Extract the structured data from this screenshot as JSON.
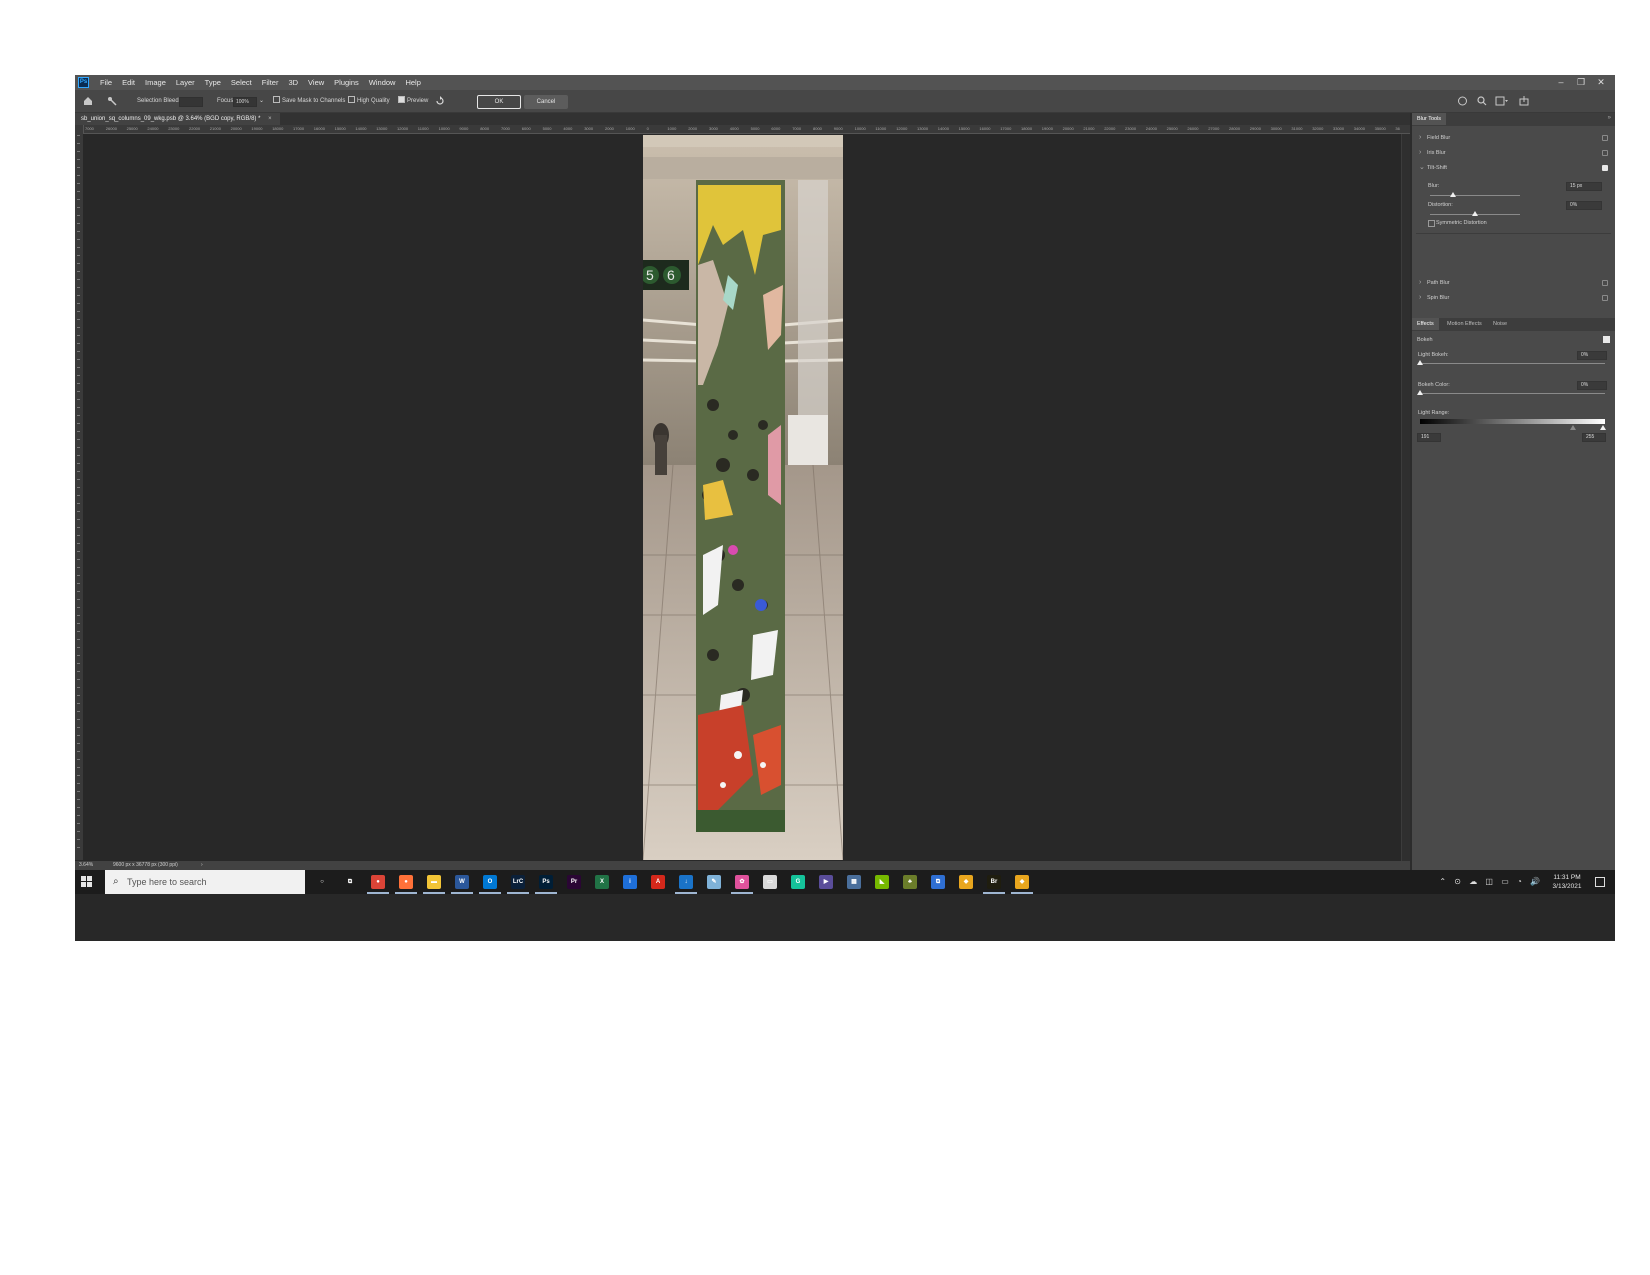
{
  "app": {
    "logo": "Ps",
    "menus": [
      "File",
      "Edit",
      "Image",
      "Layer",
      "Type",
      "Select",
      "Filter",
      "3D",
      "View",
      "Plugins",
      "Window",
      "Help"
    ],
    "window_controls": [
      "–",
      "❐",
      "✕"
    ]
  },
  "options_bar": {
    "selection_bleed_label": "Selection Bleed:",
    "focus_label": "Focus:",
    "focus_value": "100%",
    "save_mask_label": "Save Mask to Channels",
    "high_quality_label": "High Quality",
    "preview_label": "Preview",
    "preview_checked": true,
    "ok_label": "OK",
    "cancel_label": "Cancel"
  },
  "document": {
    "tab_title": "sb_union_sq_columns_09_wkg.psb @ 3.64% (BGD copy, RGB/8) *",
    "tab_close": "×",
    "ruler_ticks": [
      "7000",
      "26000",
      "25000",
      "24000",
      "23000",
      "22000",
      "21000",
      "20000",
      "19000",
      "18000",
      "17000",
      "16000",
      "15000",
      "14000",
      "13000",
      "12000",
      "11000",
      "10000",
      "9000",
      "8000",
      "7000",
      "6000",
      "5000",
      "4000",
      "3000",
      "2000",
      "1000",
      "0",
      "1000",
      "2000",
      "3000",
      "4000",
      "5000",
      "6000",
      "7000",
      "8000",
      "9000",
      "10000",
      "11000",
      "12000",
      "13000",
      "14000",
      "15000",
      "16000",
      "17000",
      "18000",
      "19000",
      "20000",
      "21000",
      "22000",
      "23000",
      "24000",
      "25000",
      "26000",
      "27000",
      "28000",
      "29000",
      "30000",
      "31000",
      "32000",
      "33000",
      "34000",
      "35000",
      "36"
    ],
    "platform_signs": [
      "5",
      "6"
    ]
  },
  "status_bar": {
    "zoom": "3.64%",
    "dimensions": "9600 px x 36778 px (300 ppi)",
    "arrow": "›"
  },
  "blur_tools": {
    "title": "Blur Tools",
    "items": [
      {
        "label": "Field Blur",
        "checked": false
      },
      {
        "label": "Iris Blur",
        "checked": false
      },
      {
        "label": "Tilt-Shift",
        "checked": true
      },
      {
        "label": "Path Blur",
        "checked": false
      },
      {
        "label": "Spin Blur",
        "checked": false
      }
    ],
    "blur_label": "Blur:",
    "blur_value": "15 px",
    "blur_level": 0.25,
    "distortion_label": "Distortion:",
    "distortion_value": "0%",
    "distortion_level": 0.5,
    "symmetric_label": "Symmetric Distortion"
  },
  "effects": {
    "tabs": [
      "Effects",
      "Motion Effects",
      "Noise"
    ],
    "bokeh_label": "Bokeh",
    "bokeh_checked": true,
    "light_bokeh_label": "Light Bokeh:",
    "light_bokeh_value": "0%",
    "bokeh_color_label": "Bokeh Color:",
    "bokeh_color_value": "0%",
    "light_range_label": "Light Range:",
    "light_range_low": "191",
    "light_range_high": "255"
  },
  "taskbar": {
    "search_placeholder": "Type here to search",
    "apps": [
      {
        "name": "cortana-icon",
        "color": "#1c1c1c",
        "glyph": "○"
      },
      {
        "name": "task-view-icon",
        "color": "#1c1c1c",
        "glyph": "⧉"
      },
      {
        "name": "chrome-icon",
        "color": "#db4437",
        "glyph": "●"
      },
      {
        "name": "firefox-icon",
        "color": "#ff7139",
        "glyph": "●"
      },
      {
        "name": "file-explorer-icon",
        "color": "#f3c537",
        "glyph": "▬"
      },
      {
        "name": "word-icon",
        "color": "#2b579a",
        "glyph": "W"
      },
      {
        "name": "outlook-icon",
        "color": "#0078d4",
        "glyph": "O"
      },
      {
        "name": "lightroom-classic-icon",
        "color": "#0b2039",
        "glyph": "LrC"
      },
      {
        "name": "photoshop-icon",
        "color": "#001e36",
        "glyph": "Ps"
      },
      {
        "name": "premiere-icon",
        "color": "#2a0634",
        "glyph": "Pr"
      },
      {
        "name": "excel-icon",
        "color": "#217346",
        "glyph": "X"
      },
      {
        "name": "info-app-icon",
        "color": "#1e6fd9",
        "glyph": "i"
      },
      {
        "name": "acrobat-icon",
        "color": "#d4281b",
        "glyph": "A"
      },
      {
        "name": "download-app-icon",
        "color": "#1a73c8",
        "glyph": "↓"
      },
      {
        "name": "notes-app-icon",
        "color": "#7fb2d8",
        "glyph": "✎"
      },
      {
        "name": "photos-app-icon",
        "color": "#e0529c",
        "glyph": "✿"
      },
      {
        "name": "monitor-app-icon",
        "color": "#dadada",
        "glyph": "▭"
      },
      {
        "name": "grammarly-icon",
        "color": "#15c39a",
        "glyph": "G"
      },
      {
        "name": "media-app-icon",
        "color": "#5a4d9a",
        "glyph": "▶"
      },
      {
        "name": "calculator-icon",
        "color": "#4a6f9c",
        "glyph": "▦"
      },
      {
        "name": "nvidia-icon",
        "color": "#76b900",
        "glyph": "◣"
      },
      {
        "name": "game-app-icon",
        "color": "#6b7d2a",
        "glyph": "♣"
      },
      {
        "name": "snip-app-icon",
        "color": "#2f6fd3",
        "glyph": "⧉"
      },
      {
        "name": "cyberduck-icon",
        "color": "#e9a61e",
        "glyph": "◆"
      },
      {
        "name": "bridge-icon",
        "color": "#1f1d0f",
        "glyph": "Br"
      },
      {
        "name": "cyberduck-2-icon",
        "color": "#e9a61e",
        "glyph": "◆"
      }
    ],
    "tray_icons": "⌃ ⊙ ☁ ◫ ▭ ◔ 🔊",
    "time": "11:31 PM",
    "date": "3/13/2021"
  },
  "colors": {
    "accent": "#31a8ff",
    "canvas_bg": "#282828",
    "panel_bg": "#4a4a4a",
    "column_yellow": "#e0c43a",
    "column_green": "#5a6a45",
    "column_red": "#c8402a"
  }
}
